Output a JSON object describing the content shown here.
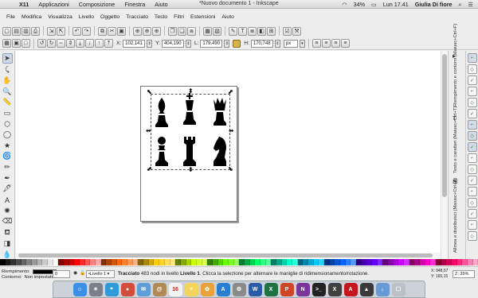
{
  "mac_menubar": {
    "apple": "",
    "items": [
      {
        "label": "X11",
        "bold": true
      },
      {
        "label": "Applicazioni"
      },
      {
        "label": "Composizione"
      },
      {
        "label": "Finestra"
      },
      {
        "label": "Aiuto"
      }
    ],
    "window_title": "*Nuovo documento 1 - Inkscape",
    "status": {
      "battery": "34%",
      "clock": "Lun 17.41",
      "user": "Giulia Di fiore"
    }
  },
  "app_menu": [
    "File",
    "Modifica",
    "Visualizza",
    "Livello",
    "Oggetto",
    "Tracciato",
    "Testo",
    "Filtri",
    "Estensioni",
    "Aiuto"
  ],
  "command_bar": {
    "icons": [
      "new-icon",
      "open-icon",
      "save-icon",
      "print-icon",
      "import-icon",
      "export-icon",
      "undo-icon",
      "redo-icon",
      "copy-icon",
      "cut-icon",
      "paste-icon",
      "zoom-selection-icon",
      "zoom-drawing-icon",
      "zoom-page-icon",
      "duplicate-icon",
      "clone-icon",
      "unlink-clone-icon",
      "group-icon",
      "ungroup-icon",
      "fill-stroke-icon",
      "text-font-icon",
      "layers-icon",
      "xml-editor-icon",
      "align-icon",
      "document-properties-icon",
      "preferences-icon"
    ]
  },
  "controls": {
    "x_label": "X:",
    "x_value": "102,141",
    "y_label": "Y:",
    "y_value": "404,190",
    "w_label": "L:",
    "w_value": "179,490",
    "h_label": "H:",
    "h_value": "170,748",
    "unit": "px"
  },
  "toolbox": [
    "selector-tool-icon",
    "node-tool-icon",
    "tweak-tool-icon",
    "zoom-tool-icon",
    "measure-tool-icon",
    "rect-tool-icon",
    "3dbox-tool-icon",
    "ellipse-tool-icon",
    "star-tool-icon",
    "spiral-tool-icon",
    "pencil-tool-icon",
    "pen-tool-icon",
    "calligraphy-tool-icon",
    "text-tool-icon",
    "spray-tool-icon",
    "eraser-tool-icon",
    "bucket-tool-icon",
    "gradient-tool-icon",
    "dropper-tool-icon"
  ],
  "canvas": {
    "pieces": [
      "bishop",
      "king",
      "queen",
      "pawn",
      "rook",
      "knight"
    ]
  },
  "right_dock": {
    "panel_fill": "Riempimento e contorni (Maiusc+Ctrl+F)",
    "panel_text": "Testo e caratteri (Maiusc+Ctrl+T)",
    "panel_align": "Allinea e distribuisci (Maiusc+Ctrl+A)"
  },
  "status_bar": {
    "fill_label": "Riempimento:",
    "fill_value": "",
    "stroke_label": "Contorno:",
    "stroke_value": "Non impostato",
    "opacity": "0",
    "layer": "•Livello 1",
    "message_prefix": "Tracciato",
    "message_body": " 483 nodi in livello ",
    "message_layer": "Livello 1",
    "message_suffix": ". Clicca la selezione per alternare le maniglie di ridimensionamento/rotazione.",
    "coord_x": "X: 948,57",
    "coord_y": "Y: 165,15",
    "zoom_label": "Z:",
    "zoom": "35%"
  },
  "palette_colors": [
    "#000000",
    "#1a1a1a",
    "#333333",
    "#4d4d4d",
    "#666666",
    "#808080",
    "#999999",
    "#b3b3b3",
    "#cccccc",
    "#e6e6e6",
    "#ffffff",
    "#800000",
    "#aa0000",
    "#d40000",
    "#ff0000",
    "#ff2a2a",
    "#ff5555",
    "#ff8080",
    "#ffaaaa",
    "#803300",
    "#aa4400",
    "#d45500",
    "#ff6600",
    "#ff7f2a",
    "#ff9955",
    "#ffb380",
    "#806600",
    "#aa8800",
    "#d4aa00",
    "#ffcc00",
    "#ffd42a",
    "#ffdd55",
    "#ffe680",
    "#668000",
    "#88aa00",
    "#aad400",
    "#ccff00",
    "#d4ff2a",
    "#ddff55",
    "#338000",
    "#44aa00",
    "#55d400",
    "#66ff00",
    "#7fff2a",
    "#99ff55",
    "#008033",
    "#00aa44",
    "#00d455",
    "#00ff66",
    "#2aff80",
    "#55ff99",
    "#008066",
    "#00aa88",
    "#00d4aa",
    "#00ffcc",
    "#2affd5",
    "#006680",
    "#0088aa",
    "#00aad4",
    "#00ccff",
    "#2ad4ff",
    "#003380",
    "#0044aa",
    "#0055d4",
    "#0066ff",
    "#2a7fff",
    "#5599ff",
    "#330080",
    "#4400aa",
    "#5500d4",
    "#6600ff",
    "#7f2aff",
    "#660080",
    "#8800aa",
    "#aa00d4",
    "#cc00ff",
    "#d42aff",
    "#800066",
    "#aa0088",
    "#d400aa",
    "#ff00cc",
    "#ff2ad4",
    "#800033",
    "#aa0044",
    "#d40055",
    "#ff0066",
    "#ff2a7f",
    "#ff5599",
    "#ff80b2",
    "#ffaacc"
  ],
  "dock_apps": [
    {
      "name": "finder-app",
      "color": "#3b8fe6",
      "glyph": "☺"
    },
    {
      "name": "launchpad-app",
      "color": "#7a7f8a",
      "glyph": "✶"
    },
    {
      "name": "safari-app",
      "color": "#2f9ad8",
      "glyph": "⌖"
    },
    {
      "name": "chrome-app",
      "color": "#d44c3c",
      "glyph": "●"
    },
    {
      "name": "mail-app",
      "color": "#5f9ed6",
      "glyph": "✉"
    },
    {
      "name": "contacts-app",
      "color": "#b08a56",
      "glyph": "@"
    },
    {
      "name": "calendar-app",
      "color": "#f2f2f2",
      "glyph": "16"
    },
    {
      "name": "notes-app",
      "color": "#f2d55a",
      "glyph": "≡"
    },
    {
      "name": "photos-app",
      "color": "#e9a23b",
      "glyph": "✿"
    },
    {
      "name": "appstore-app",
      "color": "#2b7fd1",
      "glyph": "A"
    },
    {
      "name": "preferences-app",
      "color": "#8a8a8a",
      "glyph": "⚙"
    },
    {
      "name": "word-app",
      "color": "#2a5ca8",
      "glyph": "W"
    },
    {
      "name": "excel-app",
      "color": "#207245",
      "glyph": "X"
    },
    {
      "name": "powerpoint-app",
      "color": "#d04525",
      "glyph": "P"
    },
    {
      "name": "onenote-app",
      "color": "#7a3598",
      "glyph": "N"
    },
    {
      "name": "terminal-app",
      "color": "#222222",
      "glyph": ">_"
    },
    {
      "name": "xquartz-app",
      "color": "#404040",
      "glyph": "X"
    },
    {
      "name": "acrobat-app",
      "color": "#c4161c",
      "glyph": "A"
    },
    {
      "name": "inkscape-app",
      "color": "#3a3a3a",
      "glyph": "▲"
    },
    {
      "name": "downloads-app",
      "color": "#6a9ad6",
      "glyph": "↓"
    },
    {
      "name": "trash-app",
      "color": "#b9c0c8",
      "glyph": "☐"
    }
  ]
}
